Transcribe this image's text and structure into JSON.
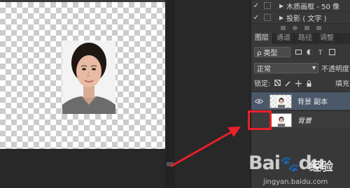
{
  "effects": [
    {
      "check": "✓",
      "label": "木质画框 - 50 像"
    },
    {
      "check": "✓",
      "label": "投影 ( 文字 )"
    }
  ],
  "panel_tabs": [
    {
      "label": "图层",
      "active": true
    },
    {
      "label": "通道",
      "active": false
    },
    {
      "label": "路径",
      "active": false
    },
    {
      "label": "调整",
      "active": false
    }
  ],
  "filter": {
    "label": "ρ 类型"
  },
  "blend": {
    "mode": "正常",
    "arrow": "▾",
    "opacity_label": "不透明度"
  },
  "lock": {
    "label": "锁定:",
    "fill_label": "填充"
  },
  "layers": [
    {
      "name": "背景 副本",
      "visible_icon": "eye-icon",
      "selected": true
    },
    {
      "name": "背景",
      "visible_icon": "none",
      "selected": false
    }
  ],
  "watermark": {
    "brand": "Bai",
    "brand2": "du",
    "cn": "经验",
    "url": "jingyan.baidu.com"
  },
  "colors": {
    "highlight": "#e8202a",
    "selected_layer": "#4b586a",
    "arrow": "#e8202a"
  }
}
